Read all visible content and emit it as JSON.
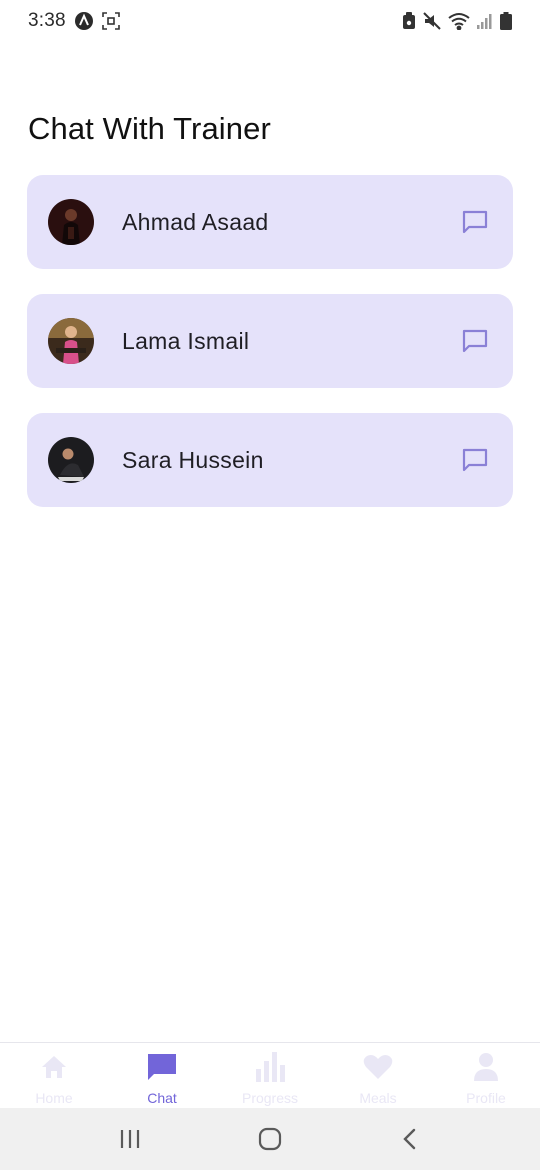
{
  "status_bar": {
    "time": "3:38",
    "icons": [
      "app-a-icon",
      "screenshot-icon",
      "alarm-lock-icon",
      "mute-icon",
      "wifi-icon",
      "signal-icon",
      "battery-icon"
    ]
  },
  "page": {
    "title": "Chat With Trainer"
  },
  "trainers": [
    {
      "name": "Ahmad Asaad",
      "avatar": "avatar-ahmad",
      "action_icon": "chat-icon"
    },
    {
      "name": "Lama Ismail",
      "avatar": "avatar-lama",
      "action_icon": "chat-icon"
    },
    {
      "name": "Sara Hussein",
      "avatar": "avatar-sara",
      "action_icon": "chat-icon"
    }
  ],
  "bottom_nav": {
    "items": [
      {
        "label": "Home",
        "icon": "home-icon",
        "active": false
      },
      {
        "label": "Chat",
        "icon": "chat-icon",
        "active": true
      },
      {
        "label": "Progress",
        "icon": "bar-chart-icon",
        "active": false
      },
      {
        "label": "Meals",
        "icon": "heart-icon",
        "active": false
      },
      {
        "label": "Profile",
        "icon": "user-icon",
        "active": false
      }
    ]
  },
  "system_nav": {
    "buttons": [
      "recents-icon",
      "home-circle-icon",
      "back-icon"
    ]
  },
  "colors": {
    "card_bg": "#e5e2fa",
    "accent": "#7265d9",
    "inactive_nav": "#e9e7f5",
    "chat_icon_stroke": "#8a80d6"
  }
}
